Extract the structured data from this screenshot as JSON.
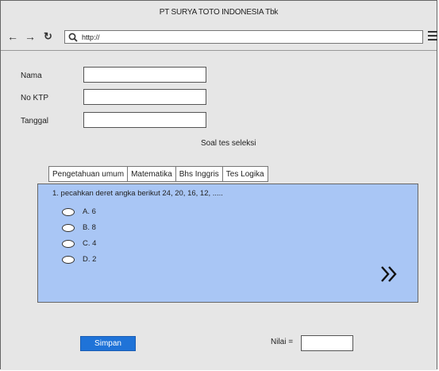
{
  "window": {
    "title": "PT SURYA TOTO INDONESIA Tbk"
  },
  "toolbar": {
    "back_icon": "arrow-left-icon",
    "forward_icon": "arrow-right-icon",
    "reload_icon": "reload-icon",
    "search_icon": "search-icon",
    "url": "http://",
    "menu_icon": "hamburger-menu-icon"
  },
  "form": {
    "name_label": "Nama",
    "name_value": "",
    "ktp_label": "No KTP",
    "ktp_value": "",
    "date_label": "Tanggal",
    "date_value": ""
  },
  "section_title": "Soal tes seleksi",
  "tabs": [
    {
      "label": "Pengetahuan umum"
    },
    {
      "label": "Matematika"
    },
    {
      "label": "Bhs Inggris"
    },
    {
      "label": "Tes Logika"
    }
  ],
  "question": {
    "text": "1. pecahkan deret angka berikut 24, 20, 16, 12, .....",
    "options": [
      {
        "label": "A. 6"
      },
      {
        "label": "B. 8"
      },
      {
        "label": "C. 4"
      },
      {
        "label": "D. 2"
      }
    ],
    "next_icon": "double-chevron-right-icon"
  },
  "actions": {
    "save_label": "Simpan"
  },
  "score": {
    "label": "Nilai =",
    "value": ""
  },
  "colors": {
    "panel": "#a9c6f5",
    "button": "#1f73d8",
    "chrome": "#e6e6e6"
  }
}
